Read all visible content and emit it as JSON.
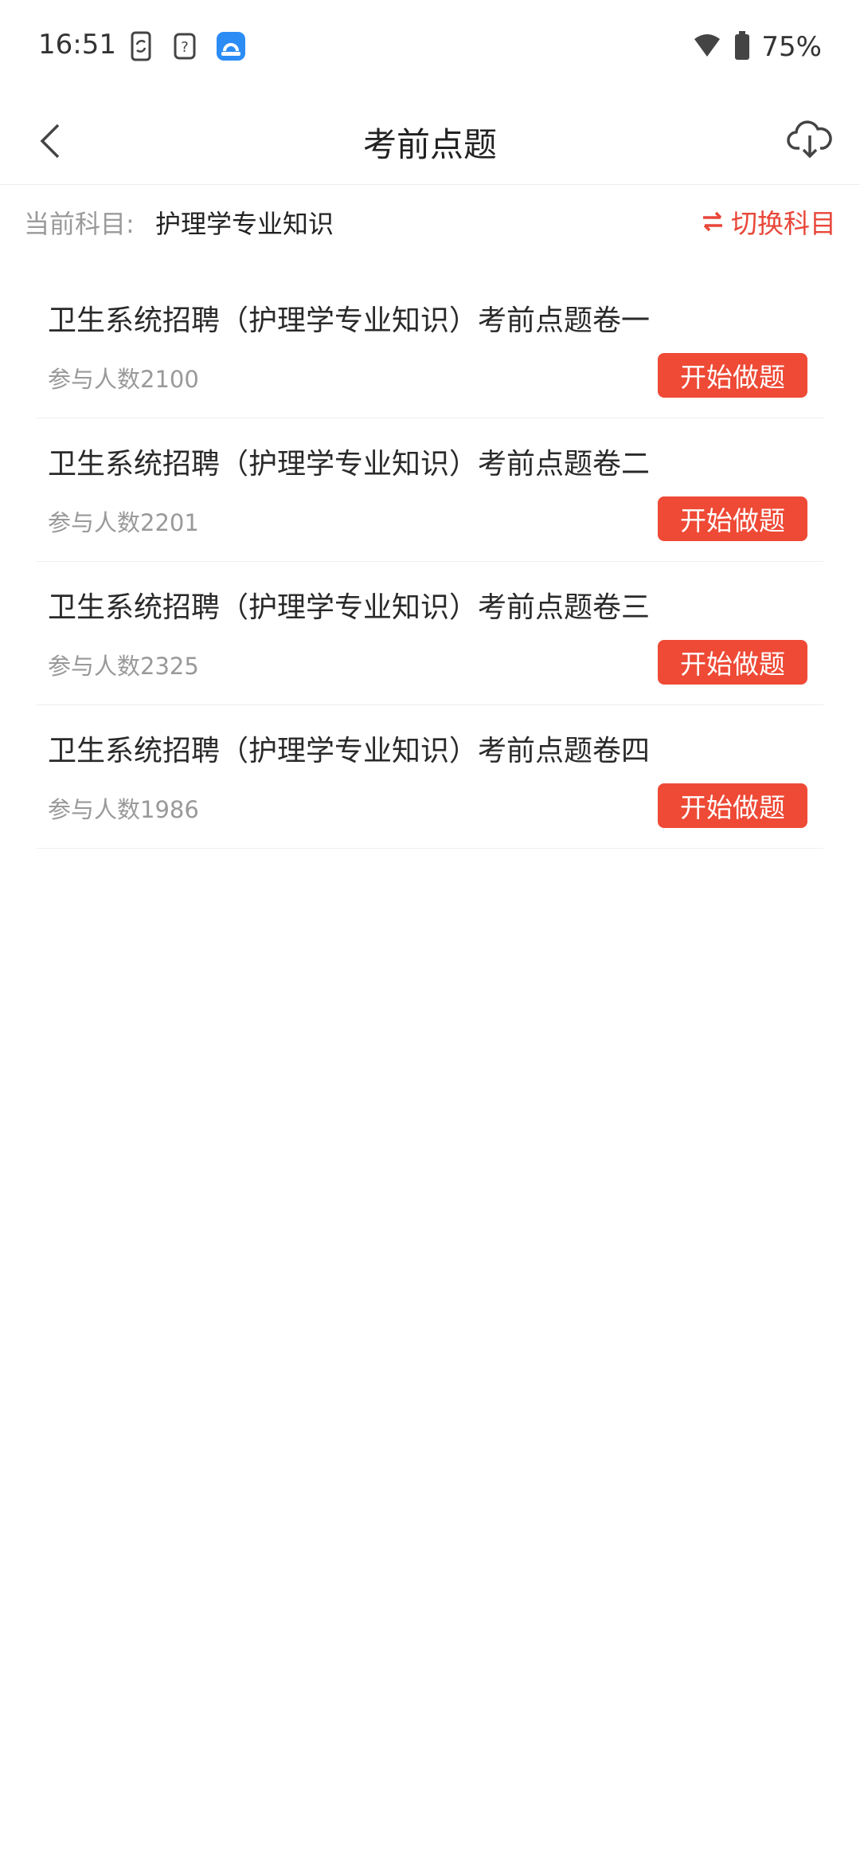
{
  "status_bar": {
    "time": "16:51",
    "battery": "75%"
  },
  "header": {
    "title": "考前点题"
  },
  "subject": {
    "label": "当前科目:",
    "value": "护理学专业知识",
    "switch_label": "切换科目"
  },
  "papers": [
    {
      "title": "卫生系统招聘（护理学专业知识）考前点题卷一",
      "participants": "参与人数2100",
      "button": "开始做题"
    },
    {
      "title": "卫生系统招聘（护理学专业知识）考前点题卷二",
      "participants": "参与人数2201",
      "button": "开始做题"
    },
    {
      "title": "卫生系统招聘（护理学专业知识）考前点题卷三",
      "participants": "参与人数2325",
      "button": "开始做题"
    },
    {
      "title": "卫生系统招聘（护理学专业知识）考前点题卷四",
      "participants": "参与人数1986",
      "button": "开始做题"
    }
  ],
  "colors": {
    "accent": "#ee4a36",
    "muted_text": "#999999"
  },
  "icons": {
    "back": "chevron-left-icon",
    "download": "cloud-download-icon",
    "switch": "swap-arrows-icon"
  }
}
